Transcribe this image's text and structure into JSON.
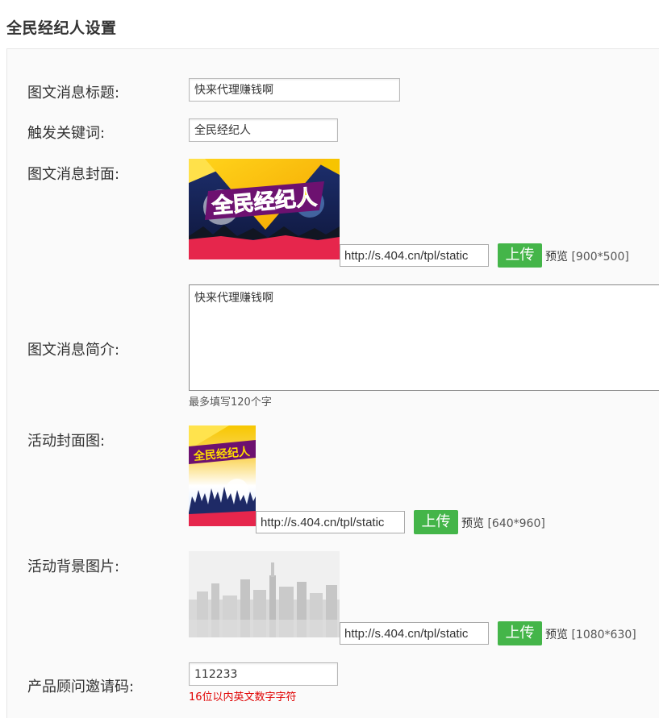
{
  "page": {
    "title": "全民经纪人设置"
  },
  "form": {
    "news_title": {
      "label": "图文消息标题:",
      "value": "快来代理赚钱啊"
    },
    "keyword": {
      "label": "触发关键词:",
      "value": "全民经纪人"
    },
    "cover": {
      "label": "图文消息封面:",
      "image_text": "全民经纪人",
      "url": "http://s.404.cn/tpl/static",
      "upload_label": "上传",
      "preview_label": "预览",
      "preview_size": "[900*500]"
    },
    "summary": {
      "label": "图文消息简介:",
      "value": "快来代理赚钱啊",
      "hint": "最多填写120个字"
    },
    "activity_cover": {
      "label": "活动封面图:",
      "image_text": "全民经纪人",
      "url": "http://s.404.cn/tpl/static",
      "upload_label": "上传",
      "preview_label": "预览",
      "preview_size": "[640*960]"
    },
    "activity_bg": {
      "label": "活动背景图片:",
      "url": "http://s.404.cn/tpl/static",
      "upload_label": "上传",
      "preview_label": "预览",
      "preview_size": "[1080*630]"
    },
    "invite_code": {
      "label": "产品顾问邀请码:",
      "value": "112233",
      "hint": "16位以内英文数字字符"
    }
  },
  "colors": {
    "upload_button": "#44b549",
    "hint_error": "#e00000",
    "panel_bg": "#fafafa"
  }
}
